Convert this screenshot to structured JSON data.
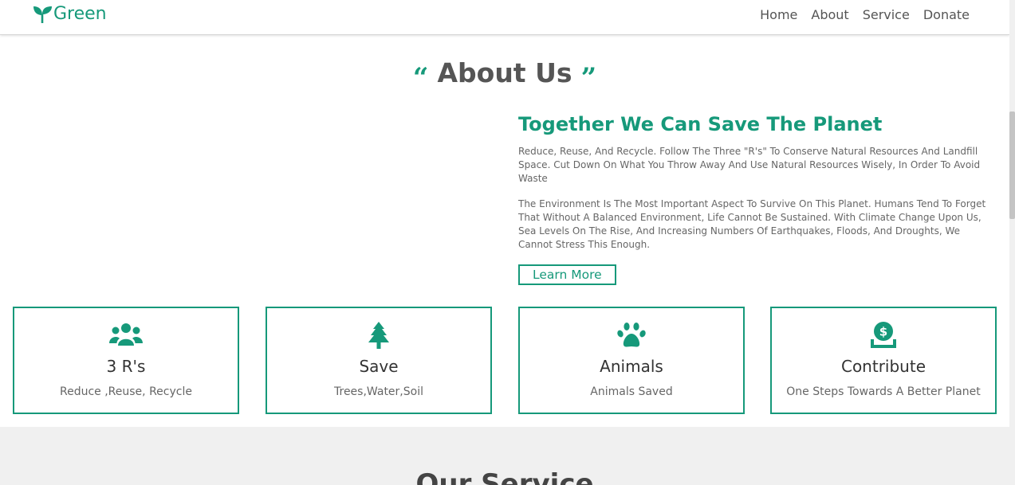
{
  "brand": {
    "name": "Green",
    "color": "#16997a",
    "icon": "sprout-icon"
  },
  "nav": {
    "items": [
      "Home",
      "About",
      "Service",
      "Donate"
    ]
  },
  "about": {
    "open_quote": "“",
    "close_quote": "”",
    "heading": "About Us",
    "subtitle": "Together We Can Save The Planet",
    "paragraph1": "Reduce, Reuse, And Recycle. Follow The Three \"R's\" To Conserve Natural Resources And Landfill Space. Cut Down On What You Throw Away And Use Natural Resources Wisely, In Order To Avoid Waste",
    "paragraph2": "The Environment Is The Most Important Aspect To Survive On This Planet. Humans Tend To Forget That Without A Balanced Environment, Life Cannot Be Sustained. With Climate Change Upon Us, Sea Levels On The Rise, And Increasing Numbers Of Earthquakes, Floods, And Droughts, We Cannot Stress This Enough.",
    "button": "Learn More"
  },
  "cards": [
    {
      "icon": "users-icon",
      "title": "3 R's",
      "subtitle": "Reduce ,Reuse, Recycle"
    },
    {
      "icon": "tree-icon",
      "title": "Save",
      "subtitle": "Trees,Water,Soil"
    },
    {
      "icon": "paw-icon",
      "title": "Animals",
      "subtitle": "Animals Saved"
    },
    {
      "icon": "donate-icon",
      "title": "Contribute",
      "subtitle": "One Steps Towards A Better Planet"
    }
  ],
  "services": {
    "heading": "Our Service"
  }
}
